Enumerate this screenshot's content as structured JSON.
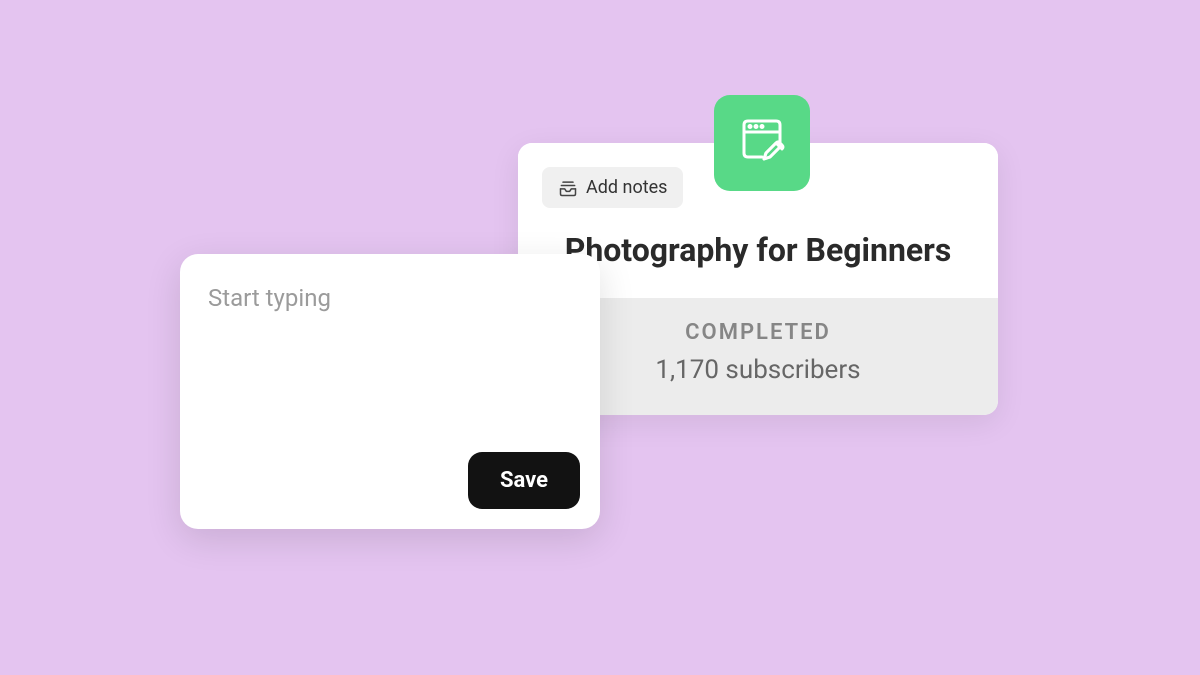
{
  "course": {
    "add_notes_label": "Add notes",
    "title": "Photography for Beginners",
    "status": "COMPLETED",
    "subscribers": "1,170 subscribers"
  },
  "note": {
    "placeholder": "Start typing",
    "save_label": "Save"
  },
  "colors": {
    "background": "#e4c4f0",
    "accent_green": "#58d987"
  }
}
